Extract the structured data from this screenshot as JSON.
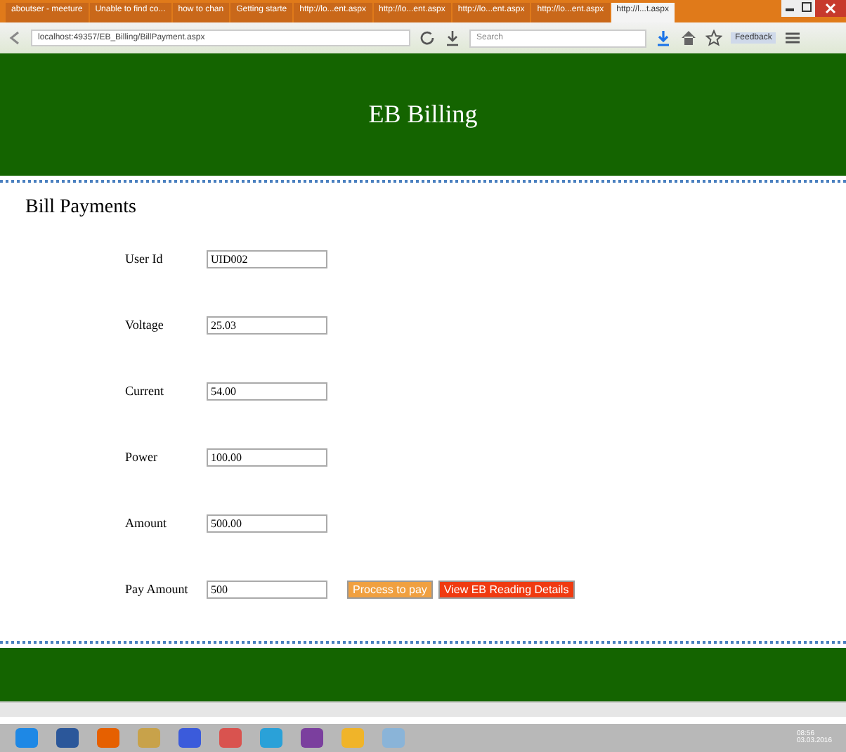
{
  "browser": {
    "tabs": [
      {
        "label": "aboutser - meeture",
        "selected": false
      },
      {
        "label": "Unable to find co...",
        "selected": false
      },
      {
        "label": "how to chan",
        "selected": false
      },
      {
        "label": "Getting starte",
        "selected": false
      },
      {
        "label": "http://lo...ent.aspx",
        "selected": false
      },
      {
        "label": "http://lo...ent.aspx",
        "selected": false
      },
      {
        "label": "http://lo...ent.aspx",
        "selected": false
      },
      {
        "label": "http://lo...ent.aspx",
        "selected": false
      },
      {
        "label": "http://l...t.aspx",
        "selected": true
      }
    ],
    "address": "localhost:49357/EB_Billing/BillPayment.aspx",
    "search_placeholder": "Search",
    "feedback": "Feedback"
  },
  "header": {
    "title": "EB Billing"
  },
  "page": {
    "heading": "Bill Payments",
    "fields": [
      {
        "label": "User Id",
        "value": "UID002"
      },
      {
        "label": "Voltage",
        "value": "25.03"
      },
      {
        "label": "Current",
        "value": "54.00"
      },
      {
        "label": "Power",
        "value": "100.00"
      },
      {
        "label": "Amount",
        "value": "500.00"
      },
      {
        "label": "Pay Amount",
        "value": "500"
      }
    ],
    "buttons": [
      {
        "label": "Process to pay",
        "kind": "process"
      },
      {
        "label": "View EB Reading Details",
        "kind": "view"
      }
    ]
  },
  "taskbar": {
    "time": "08:56",
    "date": "03.03.2016"
  }
}
